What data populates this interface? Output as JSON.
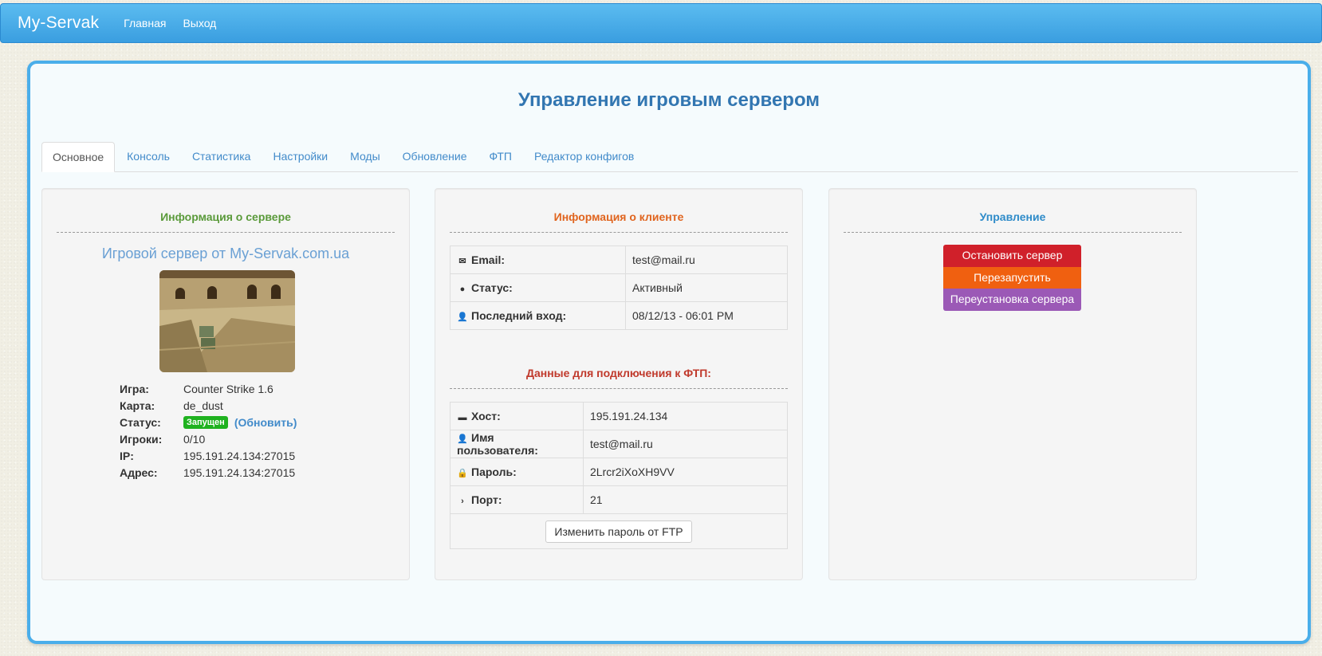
{
  "navbar": {
    "brand": "My-Servak",
    "links": [
      "Главная",
      "Выход"
    ]
  },
  "page_title": "Управление игровым сервером",
  "tabs": [
    "Основное",
    "Консоль",
    "Статистика",
    "Настройки",
    "Моды",
    "Обновление",
    "ФТП",
    "Редактор конфигов"
  ],
  "server_info": {
    "heading": "Информация о сервере",
    "name": "Игровой сервер от My-Servak.com.ua",
    "rows": [
      {
        "label": "Игра:",
        "value": "Counter Strike 1.6"
      },
      {
        "label": "Карта:",
        "value": "de_dust"
      },
      {
        "label": "Статус:",
        "value": "Запущен",
        "link": "(Обновить)"
      },
      {
        "label": "Игроки:",
        "value": "0/10"
      },
      {
        "label": "IP:",
        "value": "195.191.24.134:27015"
      },
      {
        "label": "Адрес:",
        "value": "195.191.24.134:27015"
      }
    ]
  },
  "client_info": {
    "heading": "Информация о клиенте",
    "rows": [
      {
        "icon": "envelope-icon",
        "label": "Email:",
        "value": "test@mail.ru"
      },
      {
        "icon": "exclamation-icon",
        "label": "Статус:",
        "value": "Активный"
      },
      {
        "icon": "user-icon",
        "label": "Последний вход:",
        "value": "08/12/13 - 06:01 PM"
      }
    ]
  },
  "ftp_info": {
    "heading": "Данные для подключения к ФТП:",
    "rows": [
      {
        "icon": "hdd-icon",
        "label": "Хост:",
        "value": "195.191.24.134"
      },
      {
        "icon": "user-icon",
        "label": "Имя пользователя:",
        "value": "test@mail.ru"
      },
      {
        "icon": "lock-icon",
        "label": "Пароль:",
        "value": "2Lrcr2iXoXH9VV"
      },
      {
        "icon": "chevron-right-icon",
        "label": "Порт:",
        "value": "21"
      }
    ],
    "change_password": "Изменить пароль от FTP"
  },
  "control": {
    "heading": "Управление",
    "buttons": [
      "Остановить сервер",
      "Перезапустить",
      "Переустановка сервера"
    ]
  },
  "colors": {
    "accent": "#4aaeea",
    "heading_green": "#5a9a3a",
    "heading_orange": "#e0641e",
    "heading_red": "#c0392b",
    "heading_blue": "#2e8bc9",
    "status_green": "#1fb21f"
  }
}
